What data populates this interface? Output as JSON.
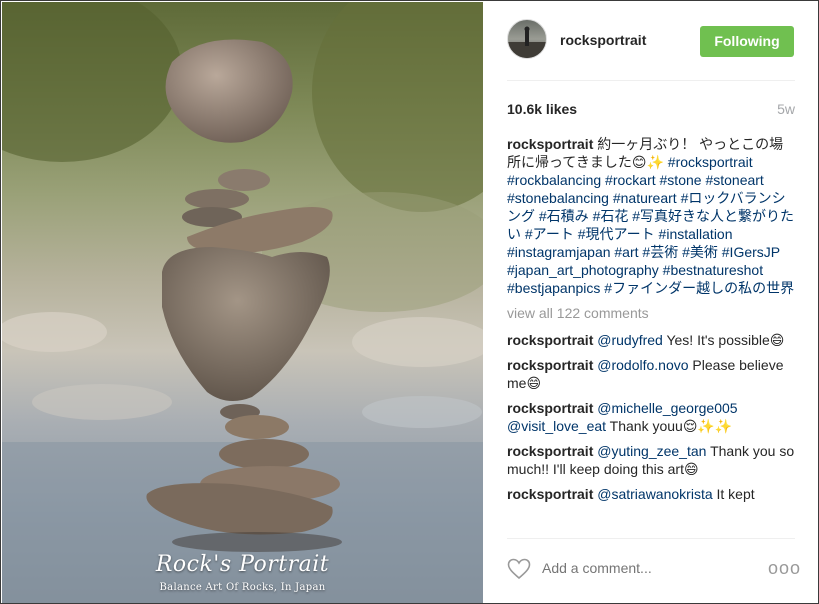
{
  "photo": {
    "watermark_title": "Rock's Portrait",
    "watermark_subtitle": "Balance Art Of Rocks, In Japan"
  },
  "header": {
    "username": "rocksportrait",
    "follow_label": "Following",
    "follow_color": "#70c050"
  },
  "stats": {
    "likes": "10.6k likes",
    "age": "5w"
  },
  "caption": {
    "user": "rocksportrait",
    "text": "約一ヶ月ぶり！ やっとこの場所に帰ってきました😊✨",
    "hashtags": "#rocksportrait #rockbalancing #rockart #stone #stoneart #stonebalancing #natureart #ロックバランシング #石積み #石花 #写真好きな人と繋がりたい #アート #現代アート #installation #instagramjapan #art #芸術 #美術 #IGersJP #japan_art_photography #bestnatureshot #bestjapanpics #ファインダー越しの私の世界"
  },
  "view_all": "view all 122 comments",
  "comments": [
    {
      "user": "rocksportrait",
      "mention": "@rudyfred",
      "text": " Yes! It's possible😄"
    },
    {
      "user": "rocksportrait",
      "mention": "@rodolfo.novo",
      "text": " Please believe me😄"
    },
    {
      "user": "rocksportrait",
      "mention": "@michelle_george005 @visit_love_eat",
      "text": " Thank youu😌✨✨"
    },
    {
      "user": "rocksportrait",
      "mention": "@yuting_zee_tan",
      "text": " Thank you so much!! I'll keep doing this art😄"
    },
    {
      "user": "rocksportrait",
      "mention": "@satriawanokrista",
      "text": " It kept"
    }
  ],
  "footer": {
    "comment_placeholder": "Add a comment...",
    "more_glyph": "ooo",
    "heart_icon": "heart-outline-icon"
  }
}
